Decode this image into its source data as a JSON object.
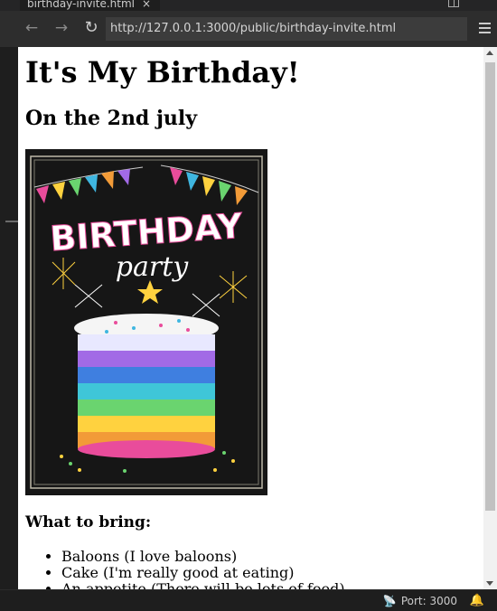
{
  "editor": {
    "tab_title": "birthday-invite.html",
    "tab_close": "×"
  },
  "browser": {
    "back": "←",
    "forward": "→",
    "reload": "↻",
    "url": "http://127.0.0.1:3000/public/birthday-invite.html"
  },
  "page": {
    "heading": "It's My Birthday!",
    "subheading": "On the 2nd july",
    "poster": {
      "title": "BIRTHDAY",
      "subtitle": "party"
    },
    "bring_heading": "What to bring:",
    "bring_items": [
      "Baloons (I love baloons)",
      "Cake (I'm really good at eating)",
      "An appetite (There will be lots of food)"
    ]
  },
  "status": {
    "port_label": "Port: 3000"
  },
  "colors": {
    "editor_bg": "#1e1e1e",
    "urlbar_bg": "#3c3c3c",
    "poster_bg": "#111111"
  }
}
